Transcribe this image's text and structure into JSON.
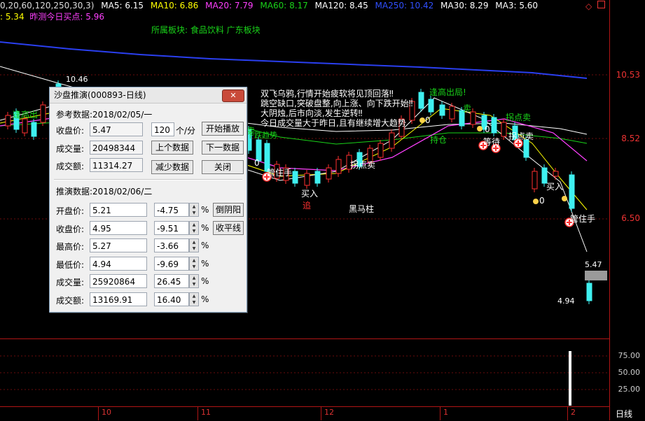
{
  "header": {
    "params": "0,20,60,120,250,30,3)",
    "ma": [
      {
        "label": "MA5: 6.15",
        "color": "#ffffff"
      },
      {
        "label": "MA10: 6.86",
        "color": "#ffff00"
      },
      {
        "label": "MA20: 7.79",
        "color": "#ff40ff"
      },
      {
        "label": "MA60: 8.17",
        "color": "#19d219"
      },
      {
        "label": "MA120: 8.45",
        "color": "#ffffff"
      },
      {
        "label": "MA250: 10.42",
        "color": "#3050ff"
      },
      {
        "label": "MA30: 8.29",
        "color": "#ffffff"
      },
      {
        "label": "MA3: 5.60",
        "color": "#ffffff"
      }
    ],
    "row2_left": ": 5.34",
    "row2_right": "昨测今日买点: 5.96",
    "board": "所属板块: 食品饮料  广东板块"
  },
  "price_axis": [
    "10.53",
    "8.52",
    "6.50"
  ],
  "sub_axis": [
    "75.00",
    "50.00",
    "25.00"
  ],
  "time_axis": {
    "labels": [
      "10",
      "11",
      "12",
      "1",
      "2"
    ],
    "period": "日线"
  },
  "chart_labels": {
    "high_price": "10.46",
    "last_high": "5.47",
    "last_low": "4.94",
    "note_lines": [
      "双飞乌鸦,行情开始疲软将见顶回落‼",
      "跳空缺口,突破盘整,向上涨、向下跌开始‼",
      "大阴烛,后市向淡,发生逆转‼",
      "今日成交量大于昨日,且有继续增大趋势"
    ],
    "escape1": "逢高出",
    "escape2": "逢高出局!",
    "sell1": "卖",
    "sell2": "卖",
    "dance": "下跌趋势",
    "hold1": "持仓",
    "buy1": "买入",
    "buy2": "买入",
    "chase": "追",
    "black_horse": "黑马柱",
    "wait": "等待",
    "guanzhu1": "管住手",
    "guanzhu2": "管住手",
    "guaidian1": "拐点卖",
    "guaidian2": "拐点卖",
    "guaidian3": "拐点卖",
    "zero1": "0",
    "zero2": "0",
    "zero3": "0",
    "zero4": "0"
  },
  "dialog": {
    "title": "沙盘推演(000893-日线)",
    "close": "✕",
    "ref_label": "参考数据:2018/02/05/一",
    "close_price_label": "收盘价:",
    "close_price": "5.47",
    "speed_value": "120",
    "speed_unit": "个/分",
    "play_btn": "开始播放",
    "volume_label": "成交量:",
    "volume": "20498344",
    "prev_btn": "上个数据",
    "next_btn": "下一数据",
    "amount_label": "成交额:",
    "amount": "11314.27",
    "reduce_btn": "减少数据",
    "close_btn": "关闭",
    "sim_label": "推演数据:2018/02/06/二",
    "rows": [
      {
        "label": "开盘价:",
        "value": "5.21",
        "pct": "-4.75"
      },
      {
        "label": "收盘价:",
        "value": "4.95",
        "pct": "-9.51"
      },
      {
        "label": "最高价:",
        "value": "5.27",
        "pct": "-3.66"
      },
      {
        "label": "最低价:",
        "value": "4.94",
        "pct": "-9.69"
      },
      {
        "label": "成交量:",
        "value": "25920864",
        "pct": "26.45"
      },
      {
        "label": "成交额:",
        "value": "13169.91",
        "pct": "16.40"
      }
    ],
    "pct_sign": "%",
    "flip_btn": "倒阴阳",
    "flat_btn": "收平线"
  }
}
